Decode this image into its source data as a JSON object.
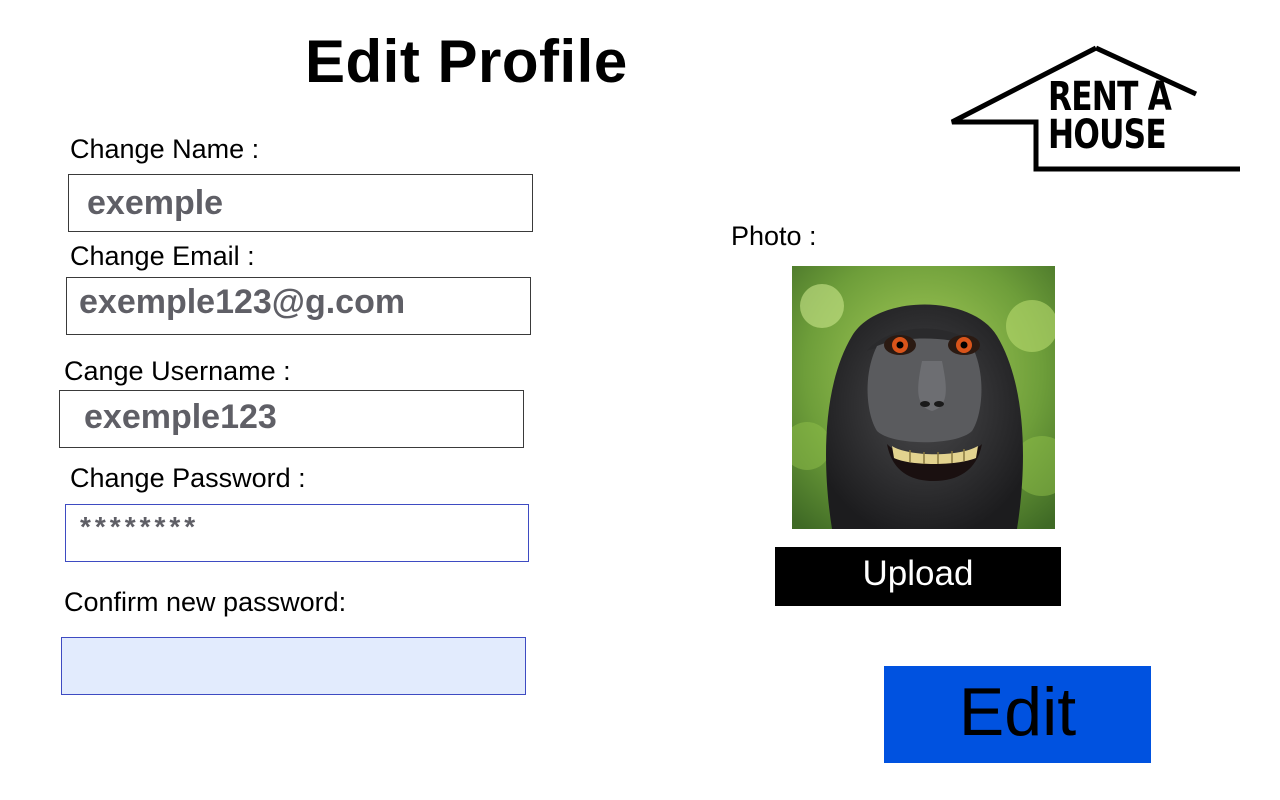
{
  "page": {
    "title": "Edit Profile"
  },
  "brand": {
    "logo_line1": "RENT A",
    "logo_line2": "HOUSE"
  },
  "form": {
    "name": {
      "label": "Change Name :",
      "value": "exemple"
    },
    "email": {
      "label": "Change Email :",
      "value": "exemple123@g.com"
    },
    "username": {
      "label": "Cange Username :",
      "value": "exemple123"
    },
    "password": {
      "label": "Change Password :",
      "value": "********"
    },
    "confirm_password": {
      "label": "Confirm new password:",
      "value": ""
    }
  },
  "photo": {
    "label": "Photo :",
    "upload_label": "Upload"
  },
  "actions": {
    "edit_label": "Edit"
  },
  "colors": {
    "edit_button": "#0052e0",
    "upload_button": "#000000",
    "input_focus_border": "#3e4bc2",
    "input_fill": "#e2ebfd"
  }
}
